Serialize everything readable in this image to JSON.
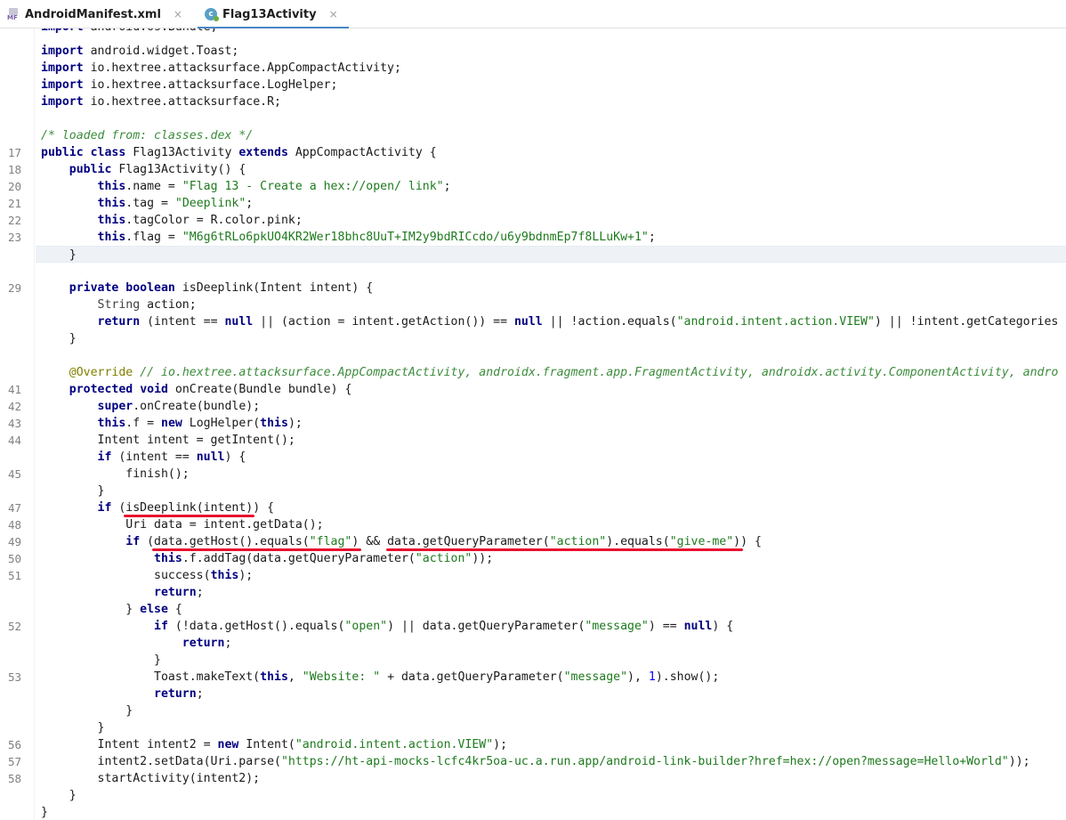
{
  "tabs": [
    {
      "label": "AndroidManifest.xml",
      "icon": "manifest-file-icon",
      "icon_text": "MF",
      "active": false
    },
    {
      "label": "Flag13Activity",
      "icon": "java-class-icon",
      "icon_text": "c",
      "active": true
    }
  ],
  "close_glyph": "×",
  "colors": {
    "keyword": "#000080",
    "string": "#1e7a1e",
    "comment": "#3c8c3c",
    "annotation": "#808000",
    "underline": "#e8102e",
    "tab_active": "#4a86c7"
  },
  "lines": [
    {
      "ln": "",
      "code": "import android.os.Bundle;",
      "partial": true
    },
    {
      "ln": "",
      "code": "import android.widget.Toast;"
    },
    {
      "ln": "",
      "code": "import io.hextree.attacksurface.AppCompactActivity;"
    },
    {
      "ln": "",
      "code": "import io.hextree.attacksurface.LogHelper;"
    },
    {
      "ln": "",
      "code": "import io.hextree.attacksurface.R;"
    },
    {
      "ln": "",
      "code": ""
    },
    {
      "ln": "",
      "code": "/* loaded from: classes.dex */"
    },
    {
      "ln": "17",
      "code": "public class Flag13Activity extends AppCompactActivity {"
    },
    {
      "ln": "18",
      "code": "    public Flag13Activity() {"
    },
    {
      "ln": "20",
      "code": "        this.name = \"Flag 13 - Create a hex://open/ link\";"
    },
    {
      "ln": "21",
      "code": "        this.tag = \"Deeplink\";"
    },
    {
      "ln": "22",
      "code": "        this.tagColor = R.color.pink;"
    },
    {
      "ln": "23",
      "code": "        this.flag = \"M6g6tRLo6pkUO4KR2Wer18bhc8UuT+IM2y9bdRICcdo/u6y9bdnmEp7f8LLuKw+1\";"
    },
    {
      "ln": "",
      "code": "    }"
    },
    {
      "ln": "",
      "code": ""
    },
    {
      "ln": "29",
      "code": "    private boolean isDeeplink(Intent intent) {"
    },
    {
      "ln": "",
      "code": "        String action;"
    },
    {
      "ln": "",
      "code": "        return (intent == null || (action = intent.getAction()) == null || !action.equals(\"android.intent.action.VIEW\") || !intent.getCategories"
    },
    {
      "ln": "",
      "code": "    }"
    },
    {
      "ln": "",
      "code": ""
    },
    {
      "ln": "",
      "code": "    @Override // io.hextree.attacksurface.AppCompactActivity, androidx.fragment.app.FragmentActivity, androidx.activity.ComponentActivity, andro"
    },
    {
      "ln": "41",
      "code": "    protected void onCreate(Bundle bundle) {"
    },
    {
      "ln": "42",
      "code": "        super.onCreate(bundle);"
    },
    {
      "ln": "43",
      "code": "        this.f = new LogHelper(this);"
    },
    {
      "ln": "44",
      "code": "        Intent intent = getIntent();"
    },
    {
      "ln": "",
      "code": "        if (intent == null) {"
    },
    {
      "ln": "45",
      "code": "            finish();"
    },
    {
      "ln": "",
      "code": "        }"
    },
    {
      "ln": "47",
      "code": "        if (isDeeplink(intent)) {"
    },
    {
      "ln": "48",
      "code": "            Uri data = intent.getData();"
    },
    {
      "ln": "49",
      "code": "            if (data.getHost().equals(\"flag\") && data.getQueryParameter(\"action\").equals(\"give-me\")) {"
    },
    {
      "ln": "50",
      "code": "                this.f.addTag(data.getQueryParameter(\"action\"));"
    },
    {
      "ln": "51",
      "code": "                success(this);"
    },
    {
      "ln": "",
      "code": "                return;"
    },
    {
      "ln": "",
      "code": "            } else {"
    },
    {
      "ln": "52",
      "code": "                if (!data.getHost().equals(\"open\") || data.getQueryParameter(\"message\") == null) {"
    },
    {
      "ln": "",
      "code": "                    return;"
    },
    {
      "ln": "",
      "code": "                }"
    },
    {
      "ln": "53",
      "code": "                Toast.makeText(this, \"Website: \" + data.getQueryParameter(\"message\"), 1).show();"
    },
    {
      "ln": "",
      "code": "                return;"
    },
    {
      "ln": "",
      "code": "            }"
    },
    {
      "ln": "",
      "code": "        }"
    },
    {
      "ln": "56",
      "code": "        Intent intent2 = new Intent(\"android.intent.action.VIEW\");"
    },
    {
      "ln": "57",
      "code": "        intent2.setData(Uri.parse(\"https://ht-api-mocks-lcfc4kr5oa-uc.a.run.app/android-link-builder?href=hex://open?message=Hello+World\"));"
    },
    {
      "ln": "58",
      "code": "        startActivity(intent2);"
    },
    {
      "ln": "",
      "code": "    }"
    },
    {
      "ln": "",
      "code": "}"
    }
  ],
  "annotations": [
    {
      "label": "underline-isDeeplink-call",
      "line": 28,
      "text": "isDeeplink(intent)"
    },
    {
      "label": "underline-host-flag",
      "line": 30,
      "text": "data.getHost().equals(\"flag\")"
    },
    {
      "label": "underline-action-give-me",
      "line": 30,
      "text": "data.getQueryParameter(\"action\").equals(\"give-me\")"
    }
  ]
}
